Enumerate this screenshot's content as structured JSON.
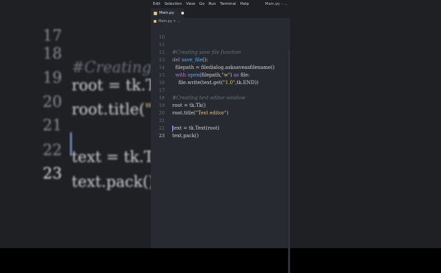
{
  "background": {
    "lines": [
      {
        "num": "17",
        "code": "#Creating text editor window"
      },
      {
        "num": "18",
        "code": "root = tk.Tk()"
      },
      {
        "num": "19",
        "code": "root.title(\"Text editor\")"
      },
      {
        "num": "20",
        "code": ""
      },
      {
        "num": "21",
        "code": "text = tk.Text(root)"
      },
      {
        "num": "22",
        "code": "text.pack()"
      },
      {
        "num": "23",
        "code": ""
      }
    ]
  },
  "menubar": {
    "items": [
      "Edit",
      "Selection",
      "View",
      "Go",
      "Run",
      "Terminal",
      "Help"
    ],
    "window_title": "Main.py - ..."
  },
  "tab": {
    "label": "Main.py"
  },
  "breadcrumb": {
    "label": "Main.py > ..."
  },
  "editor": {
    "lines": [
      {
        "num": "10",
        "code": ""
      },
      {
        "num": "11",
        "code": "#Creating save file function"
      },
      {
        "num": "12",
        "code": "def save_file():"
      },
      {
        "num": "13",
        "code": "  filepath = filedialog.asksaveasfilename()"
      },
      {
        "num": "14",
        "code": "  with open(filepath,\"w\") as file:"
      },
      {
        "num": "15",
        "code": "    file.write(text.get(\"1.0\",tk.END))"
      },
      {
        "num": "16",
        "code": ""
      },
      {
        "num": "17",
        "code": "#Creating text editor window"
      },
      {
        "num": "18",
        "code": "root = tk.Tk()"
      },
      {
        "num": "19",
        "code": "root.title(\"Text editor\")"
      },
      {
        "num": "20",
        "code": ""
      },
      {
        "num": "21",
        "code": "text = tk.Text(root)"
      },
      {
        "num": "22",
        "code": "text.pack()"
      },
      {
        "num": "23",
        "code": ""
      }
    ],
    "current_line": "23"
  },
  "colors": {
    "editor_bg": "#272a31",
    "keyword": "#c678dd",
    "function": "#61afef",
    "string": "#e5c07b",
    "comment": "#6a737d"
  },
  "icons": {
    "tab_icon": "python-file-icon",
    "modified": "unsaved-dot-icon"
  }
}
